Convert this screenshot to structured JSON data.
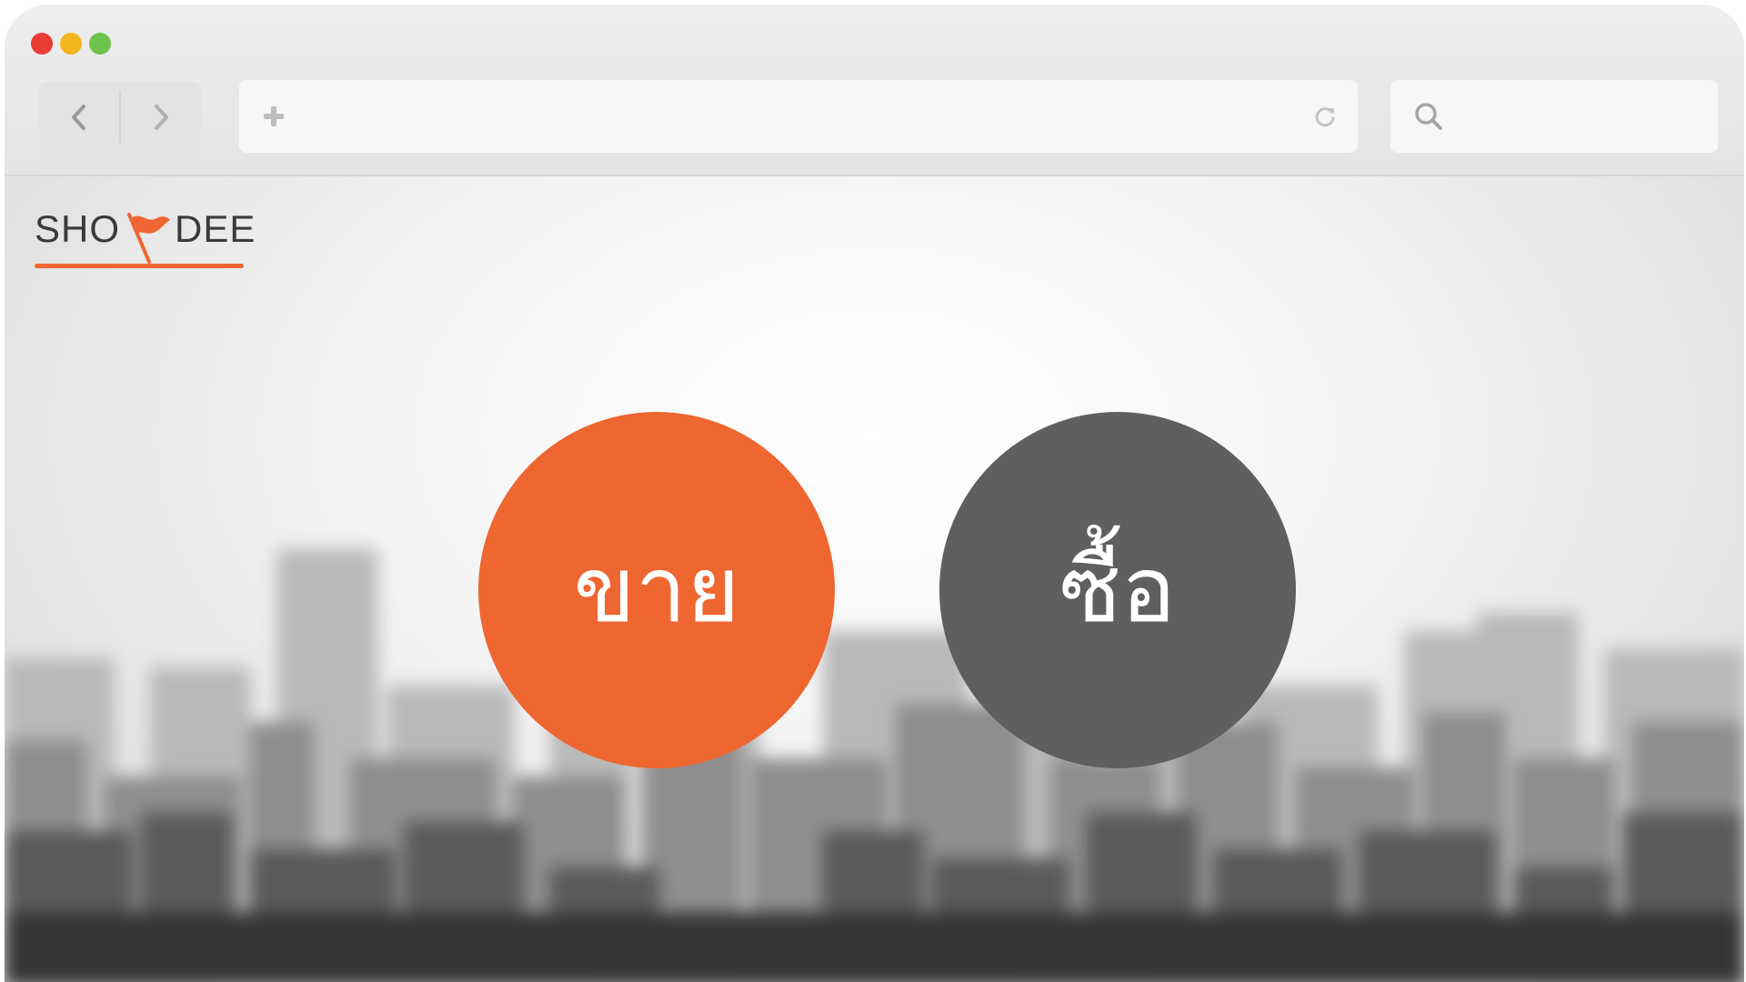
{
  "browser": {
    "traffic_lights": {
      "close_color": "#ea3c35",
      "minimize_color": "#f3b51c",
      "maximize_color": "#6cc34c"
    },
    "nav": {
      "back_icon": "chevron-left-icon",
      "forward_icon": "chevron-right-icon"
    },
    "address_bar": {
      "value": "",
      "placeholder": "",
      "left_icon": "plus-icon",
      "right_icon": "reload-icon"
    },
    "search_bar": {
      "value": "",
      "placeholder": "",
      "icon": "search-icon"
    }
  },
  "page": {
    "logo": {
      "text_left": "SHO",
      "text_right": "DEE",
      "flag_icon": "flag-icon",
      "accent_color": "#ef6633"
    },
    "buttons": {
      "sell": {
        "label": "ขาย",
        "color": "#ee6630"
      },
      "buy": {
        "label": "ซื้อ",
        "color": "#5f5f5f"
      }
    }
  }
}
